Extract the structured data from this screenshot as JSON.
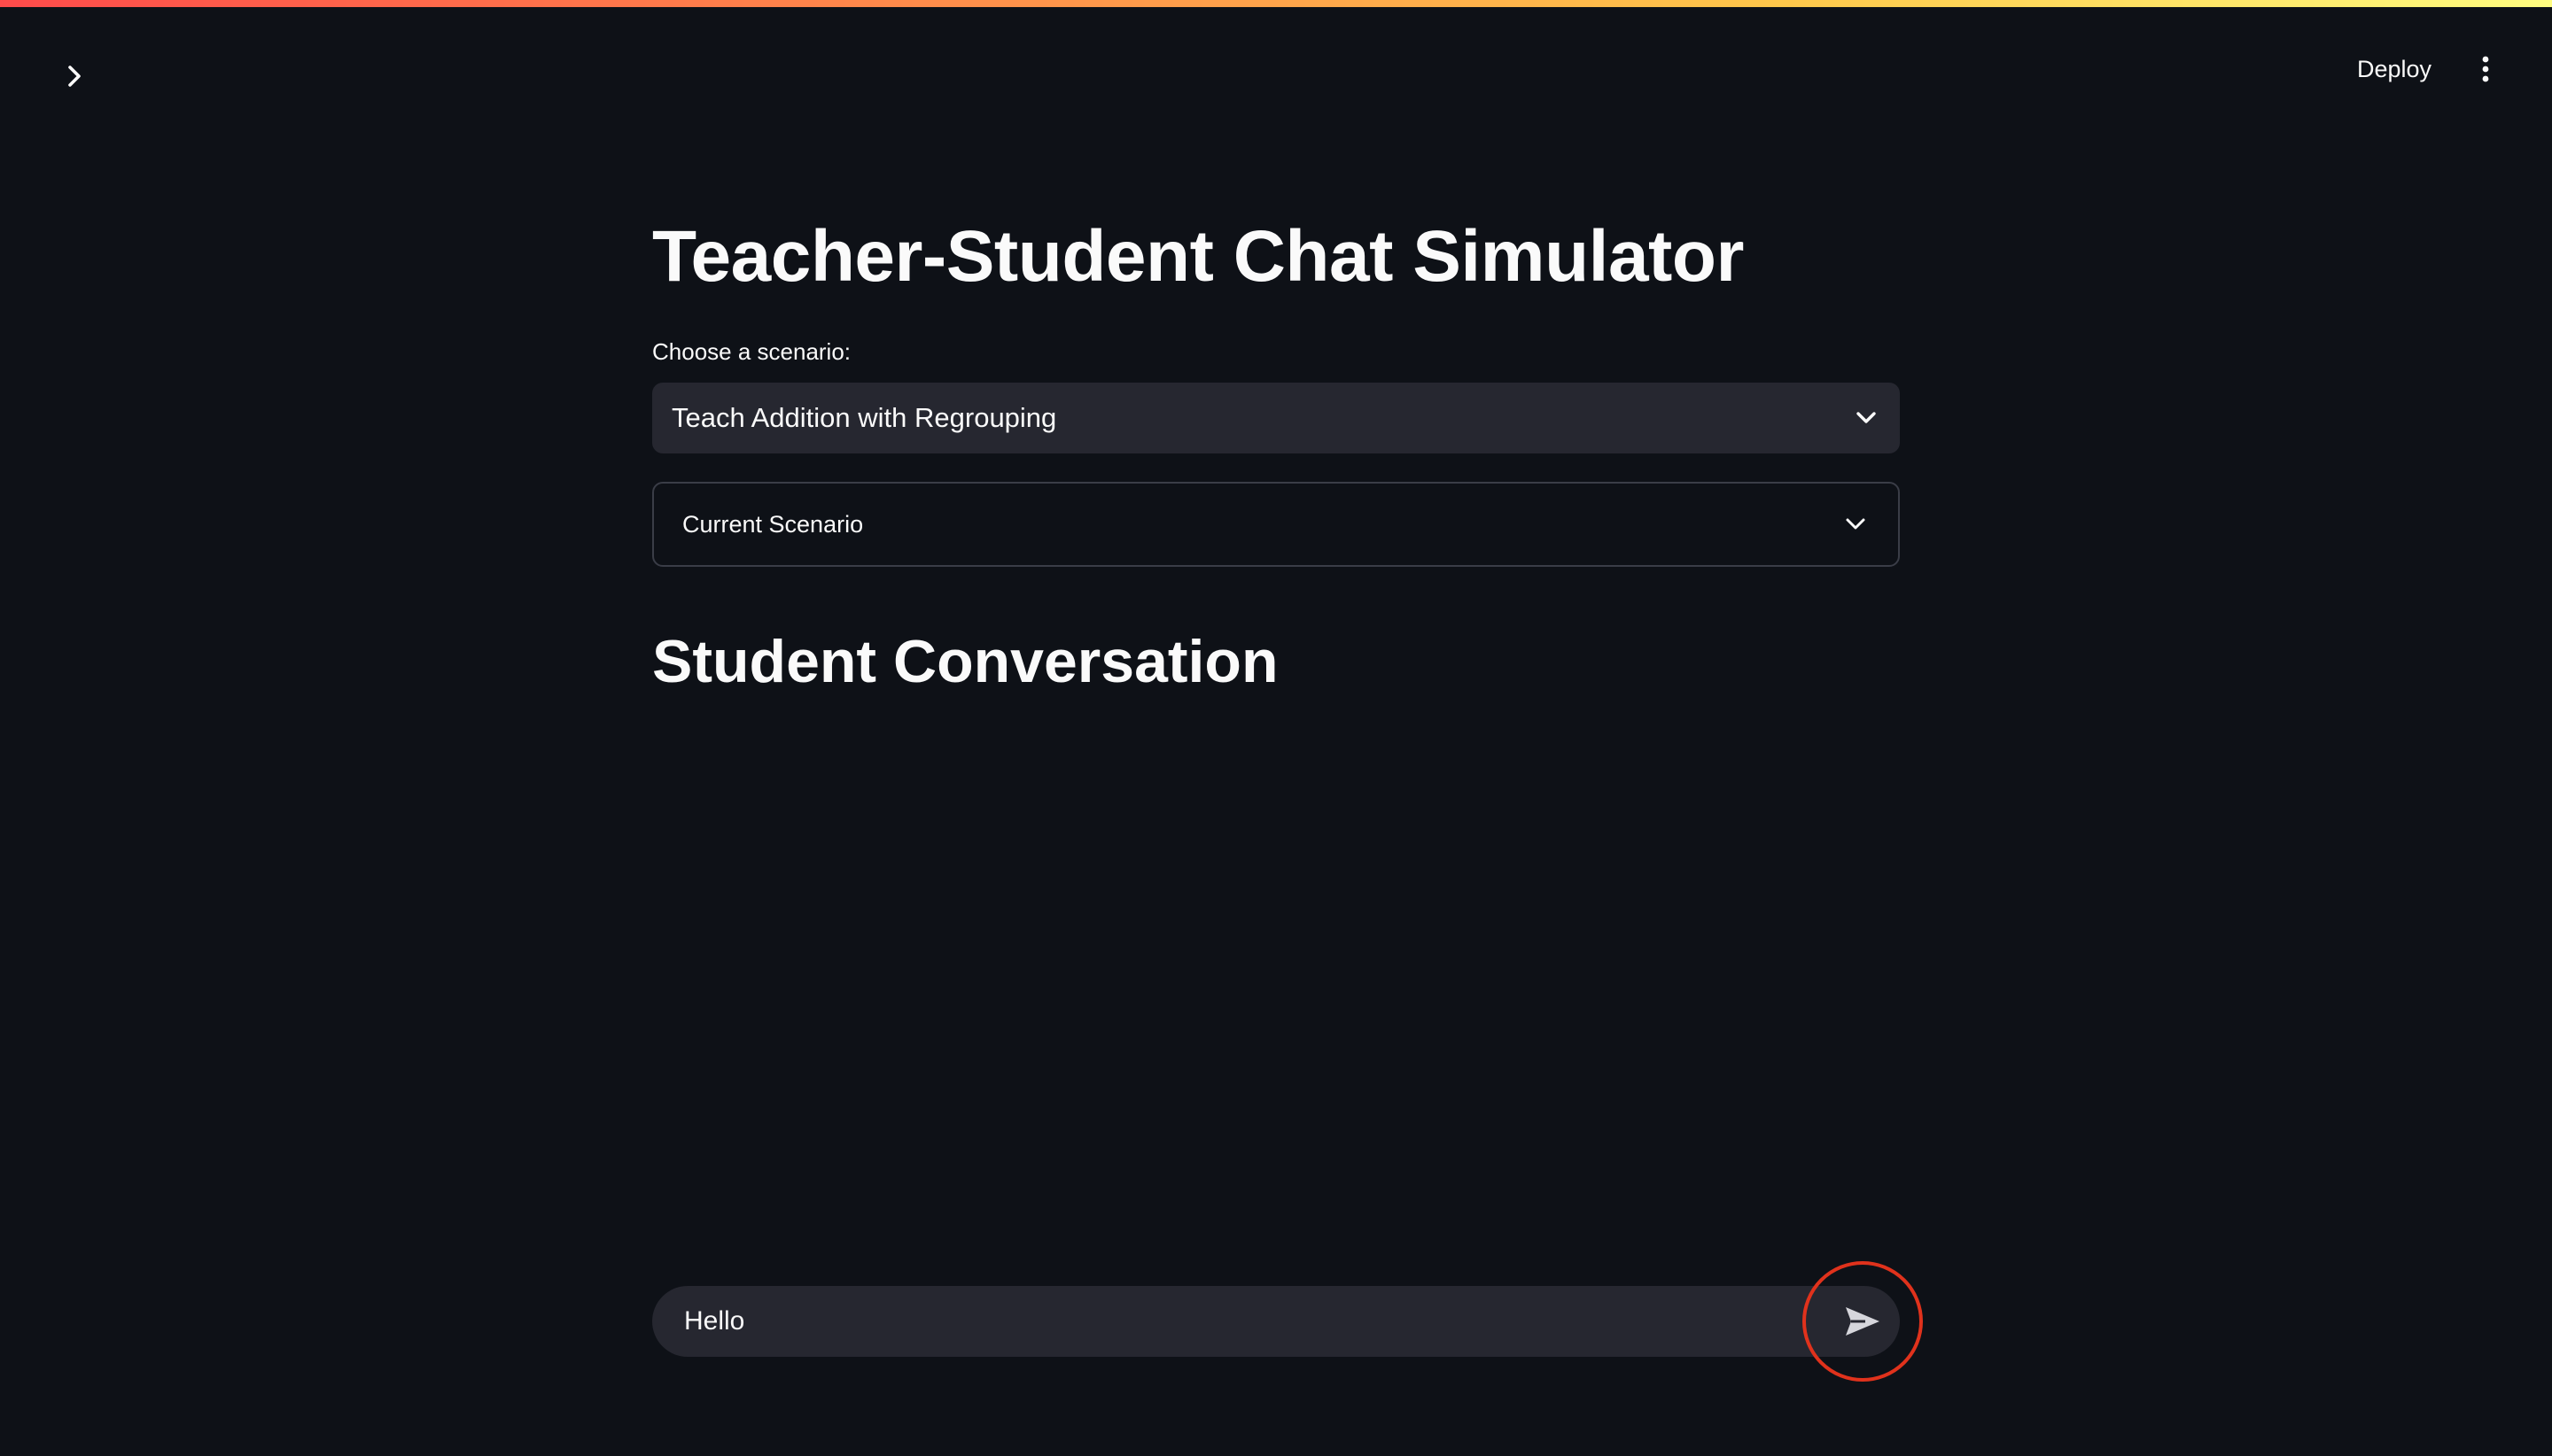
{
  "header": {
    "deploy_label": "Deploy",
    "accent_gradient": [
      "#ff4b4b",
      "#fffd80"
    ]
  },
  "icons": {
    "sidebar_toggle": "chevron-right-icon",
    "menu": "more-vertical-icon",
    "select_chevron": "chevron-down-icon",
    "expander_chevron": "chevron-down-icon",
    "send": "send-icon"
  },
  "main": {
    "title": "Teacher-Student Chat Simulator",
    "scenario_select": {
      "label": "Choose a scenario:",
      "selected": "Teach Addition with Regrouping"
    },
    "expander": {
      "label": "Current Scenario"
    },
    "conversation_title": "Student Conversation"
  },
  "chat": {
    "input_value": "Hello",
    "highlight_color": "#e0321c"
  },
  "colors": {
    "background": "#0e1117",
    "surface": "#262730",
    "text": "#fafafa"
  }
}
